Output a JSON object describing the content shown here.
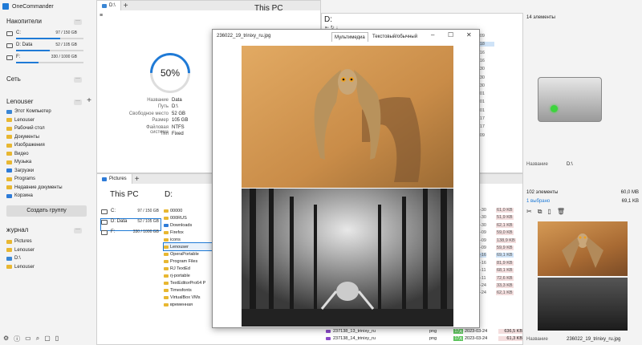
{
  "app": {
    "title": "OneCommander"
  },
  "left": {
    "drives_title": "Накопители",
    "drives": [
      {
        "name": "C:",
        "value": "97 / 150 GB",
        "fill": 0.65
      },
      {
        "name": "D:  Data",
        "value": "52 / 105 GB",
        "fill": 0.5
      },
      {
        "name": "F:",
        "value": "330 / 1000 GB",
        "fill": 0.33
      }
    ],
    "network_title": "Сеть",
    "user_title": "Lenouser",
    "favorites": [
      {
        "label": "Этот Компьютер",
        "icon": "computer-icon"
      },
      {
        "label": "Lenouser",
        "icon": "folder-icon"
      },
      {
        "label": "Рабочий стол",
        "icon": "folder-icon"
      },
      {
        "label": "Документы",
        "icon": "folder-icon"
      },
      {
        "label": "Изображения",
        "icon": "folder-icon"
      },
      {
        "label": "Видео",
        "icon": "folder-icon"
      },
      {
        "label": "Музыка",
        "icon": "folder-icon"
      },
      {
        "label": "Загрузки",
        "icon": "download-icon"
      },
      {
        "label": "Programs",
        "icon": "folder-icon"
      },
      {
        "label": "Недавние документы",
        "icon": "folder-icon"
      },
      {
        "label": "Корзина",
        "icon": "recycle-icon"
      }
    ],
    "create_group": "Создать группу",
    "journal_title": "журнал",
    "journal": [
      "Pictures",
      "Lenouser",
      "D:\\",
      "Lenouser"
    ]
  },
  "top_pane": {
    "tab": "D:\\",
    "pc_title": "This PC",
    "gauge": "50%",
    "props": [
      {
        "k": "Название",
        "v": "Data"
      },
      {
        "k": "Путь",
        "v": "D:\\"
      },
      {
        "k": "Свободное место",
        "v": "52 GB"
      },
      {
        "k": "Размер",
        "v": "105 GB"
      },
      {
        "k": "Файловая система",
        "v": "NTFS"
      },
      {
        "k": "Тип",
        "v": "Fixed"
      }
    ],
    "path": "D:"
  },
  "bottom_pane": {
    "tab": "Pictures",
    "pc_title": "This PC",
    "path": "D:",
    "drives": [
      {
        "name": "C:",
        "value": "97 / 150 GB"
      },
      {
        "name": "D:  Data",
        "value": "52 / 105 GB"
      },
      {
        "name": "F:",
        "value": "330 / 1000 GB"
      }
    ],
    "folders": [
      "00000",
      "000RUS",
      "Downloads",
      "Firefox",
      "icons",
      "Lenouser",
      "OperaPortable",
      "Program Files",
      "RJ TextEd",
      "rj-portable",
      "TextEditorPro64 P",
      "Timesfonts",
      "VirtualBox VMs",
      "временная"
    ]
  },
  "viewer": {
    "title": "236022_19_trinixy_ru.jpg",
    "tab_media": "Мультимедиа",
    "tab_text": "Текстовый/обычный"
  },
  "right_top": {
    "count": "14 элементы",
    "name_label": "Название",
    "name_value": "D:\\",
    "nums": [
      "-09",
      "-18",
      "-16",
      "-16",
      "-30",
      "-30",
      "-30",
      "-01",
      "-01",
      "-01",
      "-17",
      "-17",
      "-09"
    ]
  },
  "right_bottom": {
    "count": "102 элементы",
    "size": "60,0 MB",
    "selected": "1 выбрано",
    "selected_size": "69,1 KB",
    "name_label": "Название",
    "name_value": "236022_19_trinixy_ru.jpg",
    "sizes": [
      "61,0 KB",
      "51,9 KB",
      "62,1 KB",
      "59,0 KB",
      "138,9 KB",
      "59,9 KB",
      "69,1 KB",
      "81,9 KB",
      "68,1 KB",
      "72,6 KB",
      "33,3 KB",
      "62,1 KB",
      "636,5 KB",
      "61,3 KB"
    ],
    "dates": [
      "-30",
      "-30",
      "-30",
      "-09",
      "-09",
      "-09",
      "-16",
      "-16",
      "-11",
      "-11",
      "-24",
      "-24",
      "2023-03-24",
      "2023-03-24"
    ],
    "rows": [
      {
        "name": "237138_13_trinixy_ru",
        "ext": "png",
        "day": "17д",
        "date": "2023-03-24",
        "size": "636,5 KB"
      },
      {
        "name": "237138_14_trinixy_ru",
        "ext": "png",
        "day": "17д",
        "date": "2023-03-24",
        "size": "61,3 KB"
      }
    ]
  }
}
